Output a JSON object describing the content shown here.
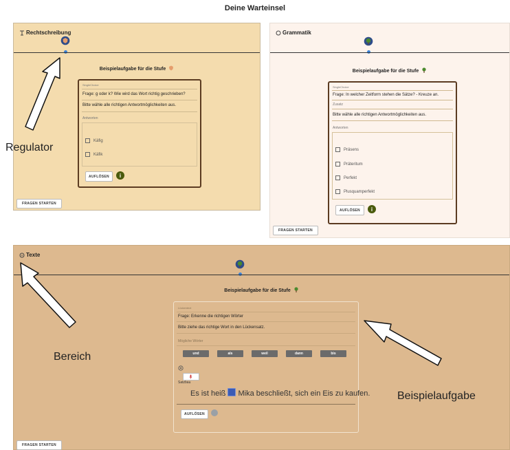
{
  "title": "Deine Warteinsel",
  "panel1": {
    "area_title": "Rechtschreibung",
    "heading": "Beispielaufgabe für die Stufe",
    "type_label": "SingleChoice",
    "question": "Frage: g oder k? Wie wird das Wort richtig geschrieben?",
    "instruction": "Bitte wähle alle richtigen Antwortmöglichkeiten aus.",
    "answers_label": "Antworten",
    "options": [
      "Käfig",
      "Käfik"
    ],
    "solve_label": "AUFLÖSEN",
    "start_label": "FRAGEN STARTEN",
    "bg_color": "#f4dcae"
  },
  "panel2": {
    "area_title": "Grammatik",
    "heading": "Beispielaufgabe für die Stufe",
    "type_label": "SingleChoice",
    "question": "Frage: In welcher Zeitform stehen die Sätze? - Kreuze an.",
    "extra_label": "Zusatz",
    "instruction": "Bitte wähle alle richtigen Antwortmöglichkeiten aus.",
    "answers_label": "Antworten",
    "options": [
      "Präsens",
      "Präteritum",
      "Perfekt",
      "Plusquamperfekt"
    ],
    "solve_label": "AUFLÖSEN",
    "start_label": "FRAGEN STARTEN",
    "bg_color": "#fdf3ec"
  },
  "panel3": {
    "area_title": "Texte",
    "heading": "Beispielaufgabe für die Stufe",
    "type_label": "Lückentext",
    "question": "Frage: Erkenne die richtigen Wörter",
    "instruction": "Bitte ziehe das richtige Wort in den Lückensatz.",
    "words_label": "Mögliche Wörter",
    "words": [
      "und",
      "als",
      "weil",
      "dann",
      "bis"
    ],
    "sentence_label": "Satzbau",
    "sentence_before": "Es ist heiß",
    "sentence_after": "Mika beschließt, sich ein Eis zu kaufen.",
    "solve_label": "AUFLÖSEN",
    "start_label": "FRAGEN STARTEN",
    "bg_color": "#ddb98f"
  },
  "annotations": {
    "regulator": "Regulator",
    "bereich": "Bereich",
    "beispielaufgabe": "Beispielaufgabe"
  },
  "icons": {
    "panel1_marker": "shield-icon",
    "panel2_marker": "tree-icon",
    "panel3_marker": "tree-icon",
    "info": "info-icon",
    "microphone": "microphone-icon"
  },
  "colors": {
    "card_border": "#5b3b21",
    "slider_dot": "#3c82d6",
    "info_badge": "#4a5a0c",
    "word_chip": "#6b6b6b"
  }
}
